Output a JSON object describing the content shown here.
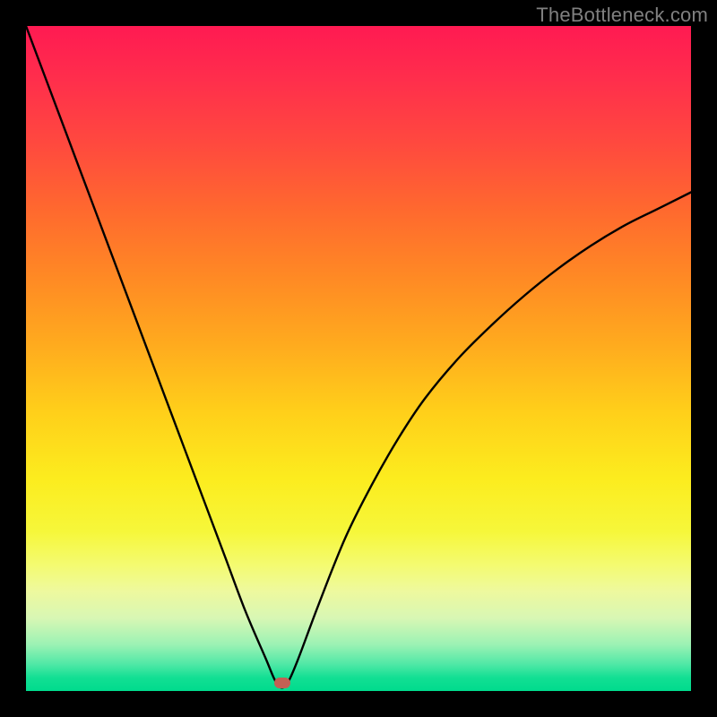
{
  "watermark": "TheBottleneck.com",
  "colors": {
    "frame": "#000000",
    "watermark": "#808080",
    "curve_stroke": "#000000",
    "marker_fill": "#c36054",
    "gradient_top": "#ff1a52",
    "gradient_mid_orange": "#ff8a24",
    "gradient_mid_yellow": "#fcec1e",
    "gradient_bottom": "#00db8d"
  },
  "chart_data": {
    "type": "line",
    "title": "",
    "xlabel": "",
    "ylabel": "",
    "xlim": [
      0,
      100
    ],
    "ylim": [
      0,
      100
    ],
    "grid": false,
    "legend": false,
    "series": [
      {
        "name": "bottleneck-curve",
        "x": [
          0,
          3,
          6,
          9,
          12,
          15,
          18,
          21,
          24,
          27,
          30,
          33,
          36,
          37.5,
          38.5,
          39.5,
          41,
          44,
          48,
          52,
          56,
          60,
          65,
          70,
          75,
          80,
          85,
          90,
          95,
          100
        ],
        "y": [
          100,
          92,
          84,
          76,
          68,
          60,
          52,
          44,
          36,
          28,
          20,
          12,
          5,
          1.5,
          0.5,
          1.5,
          5,
          13,
          23,
          31,
          38,
          44,
          50,
          55,
          59.5,
          63.5,
          67,
          70,
          72.5,
          75
        ]
      }
    ],
    "marker": {
      "x": 38.5,
      "y": 1.2
    },
    "note": "V-shaped bottleneck curve. Values are estimates read from the figure since no axis ticks are present; x and y expressed as 0-100 fractions of the plot area width/height (origin bottom-left)."
  }
}
